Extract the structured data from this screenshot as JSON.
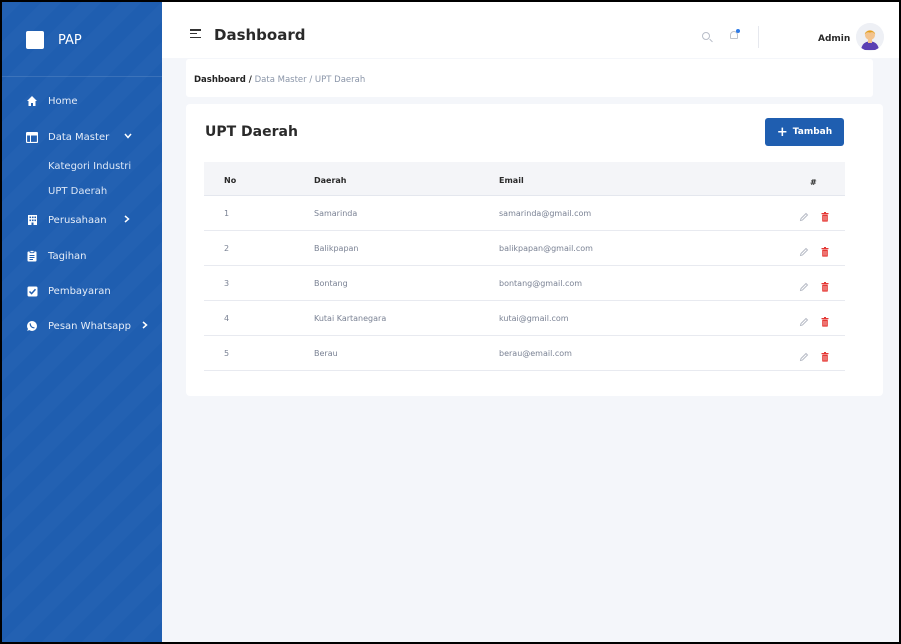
{
  "sidebar": {
    "brand": "PAP",
    "items": [
      {
        "label": "Home",
        "icon": "home-icon"
      },
      {
        "label": "Data Master",
        "icon": "table-icon",
        "caret": "chevron-down-icon"
      },
      {
        "label": "Perusahaan",
        "icon": "building-icon",
        "caret": "chevron-right-icon"
      },
      {
        "label": "Tagihan",
        "icon": "clipboard-icon"
      },
      {
        "label": "Pembayaran",
        "icon": "check-square-icon"
      },
      {
        "label": "Pesan Whatsapp",
        "icon": "whatsapp-icon",
        "caret": "chevron-right-icon"
      }
    ],
    "submenu": [
      "Kategori Industri",
      "UPT Daerah"
    ]
  },
  "topbar": {
    "title": "Dashboard",
    "user": "Admin"
  },
  "breadcrumb": {
    "root": "Dashboard /",
    "path": "Data Master / UPT Daerah"
  },
  "card": {
    "title": "UPT Daerah",
    "add_button": "Tambah"
  },
  "table": {
    "headers": {
      "no": "No",
      "daerah": "Daerah",
      "email": "Email",
      "action": "#"
    },
    "rows": [
      {
        "no": "1",
        "daerah": "Samarinda",
        "email": "samarinda@gmail.com"
      },
      {
        "no": "2",
        "daerah": "Balikpapan",
        "email": "balikpapan@gmail.com"
      },
      {
        "no": "3",
        "daerah": "Bontang",
        "email": "bontang@gmail.com"
      },
      {
        "no": "4",
        "daerah": "Kutai Kartanegara",
        "email": "kutai@gmail.com"
      },
      {
        "no": "5",
        "daerah": "Berau",
        "email": "berau@email.com"
      }
    ]
  },
  "colors": {
    "sidebar": "#1f5eb0",
    "primary": "#1f5eb0",
    "delete": "#e53935",
    "edit": "#b0b5c0"
  }
}
